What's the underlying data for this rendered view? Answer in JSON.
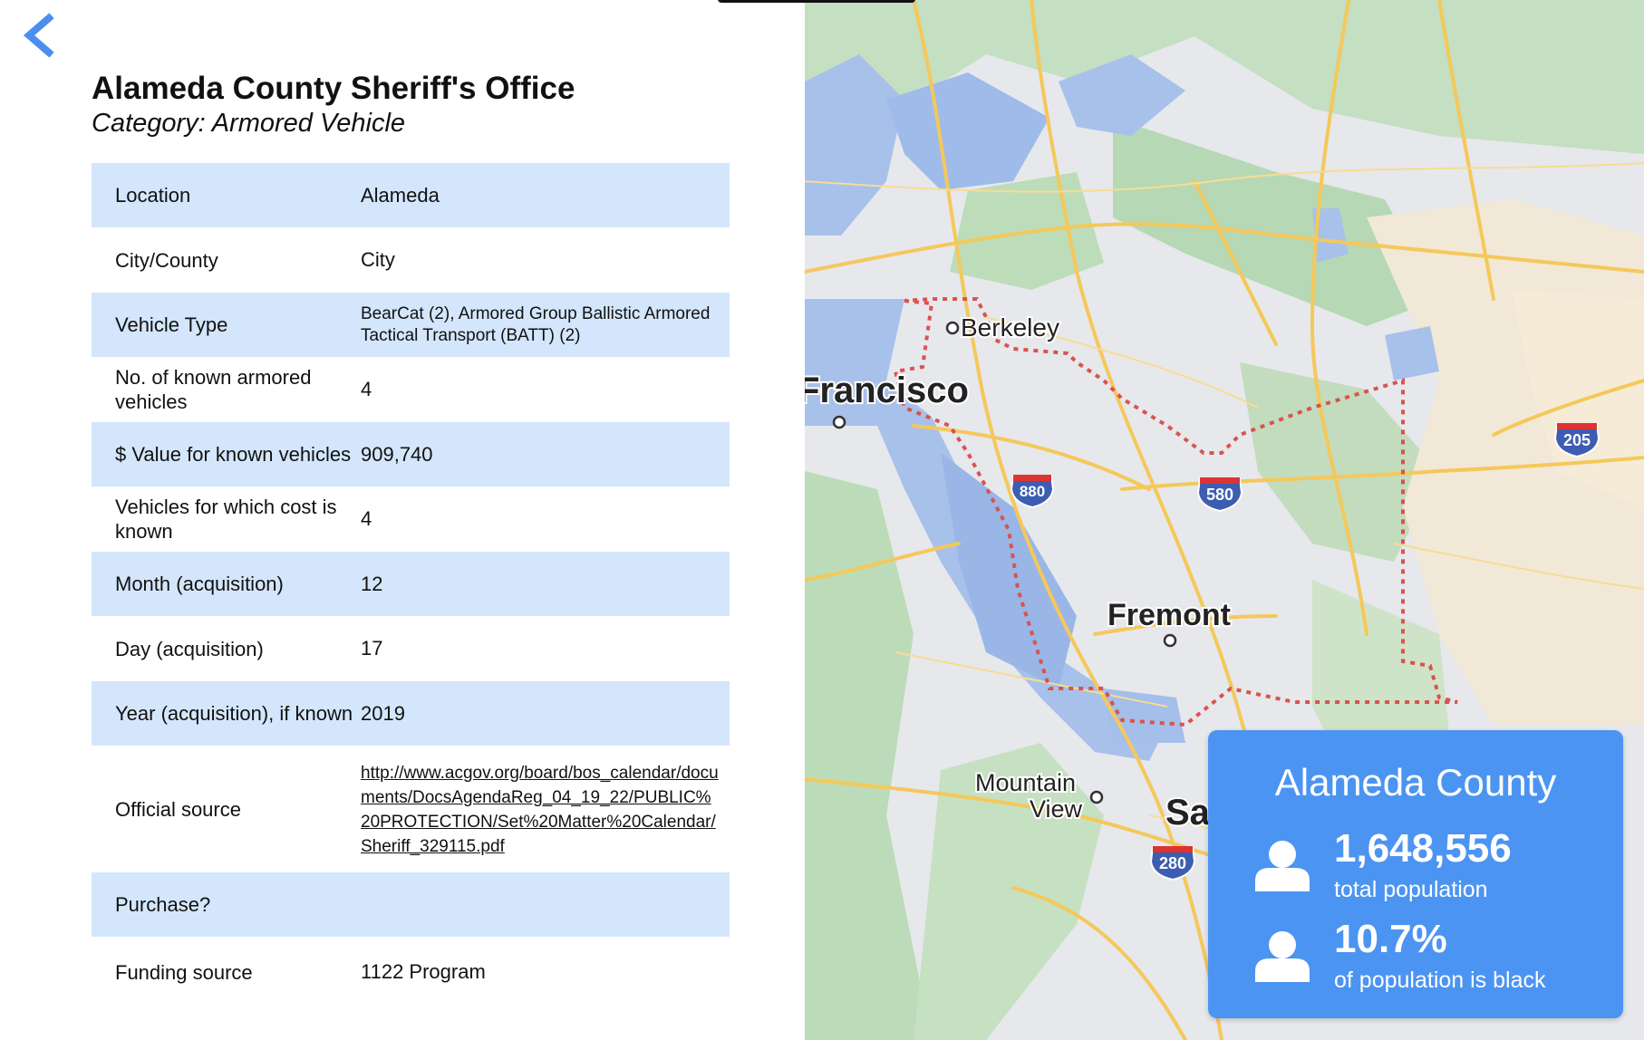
{
  "header": {
    "title": "Alameda County Sheriff's Office",
    "category_prefix": "Category:",
    "category": "Armored Vehicle"
  },
  "table": {
    "rows": [
      {
        "label": "Location",
        "value": "Alameda"
      },
      {
        "label": "City/County",
        "value": "City"
      },
      {
        "label": "Vehicle Type",
        "value": "BearCat (2), Armored Group Ballistic Armored Tactical Transport (BATT) (2)"
      },
      {
        "label": "No. of known armored vehicles",
        "value": "4"
      },
      {
        "label": "$ Value for known vehicles",
        "value": "909,740"
      },
      {
        "label": "Vehicles for which cost is known",
        "value": "4"
      },
      {
        "label": "Month (acquisition)",
        "value": "12"
      },
      {
        "label": "Day (acquisition)",
        "value": "17"
      },
      {
        "label": "Year (acquisition), if known",
        "value": "2019"
      },
      {
        "label": "Official source",
        "value": "http://www.acgov.org/board/bos_calendar/documents/DocsAgendaReg_04_19_22/PUBLIC%20PROTECTION/Set%20Matter%20Calendar/Sheriff_329115.pdf"
      },
      {
        "label": "Purchase?",
        "value": ""
      },
      {
        "label": "Funding source",
        "value": "1122 Program"
      }
    ]
  },
  "map": {
    "labels": {
      "berkeley": "Berkeley",
      "francisco": "Francisco",
      "fremont": "Fremont",
      "mountain": "Mountain",
      "view": "View",
      "sa": "Sa"
    },
    "highways": {
      "i880": "880",
      "i580": "580",
      "i205": "205",
      "i280": "280"
    }
  },
  "info_card": {
    "county": "Alameda County",
    "population": "1,648,556",
    "population_label": "total population",
    "black_pct": "10.7%",
    "black_label": "of population is black"
  },
  "colors": {
    "row_shade": "#d4e6fb",
    "accent": "#4c94f2",
    "boundary": "#d9534f"
  }
}
